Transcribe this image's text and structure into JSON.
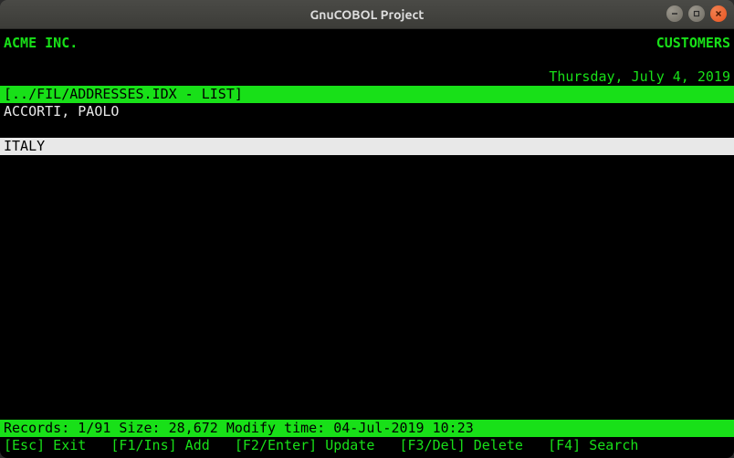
{
  "window": {
    "title": "GnuCOBOL Project"
  },
  "header": {
    "company": "ACME INC.",
    "section": "CUSTOMERS"
  },
  "date_line": "Thursday, July 4, 2019",
  "file_header": "[../FIL/ADDRESSES.IDX - LIST]",
  "record": {
    "name": "ACCORTI, PAOLO",
    "country": "ITALY"
  },
  "status_bar": "Records: 1/91 Size: 28,672 Modify time: 04-Jul-2019 10:23",
  "fkeys": {
    "esc": "[Esc] Exit",
    "f1": "[F1/Ins] Add",
    "f2": "[F2/Enter] Update",
    "f3": "[F3/Del] Delete",
    "f4": "[F4] Search"
  }
}
